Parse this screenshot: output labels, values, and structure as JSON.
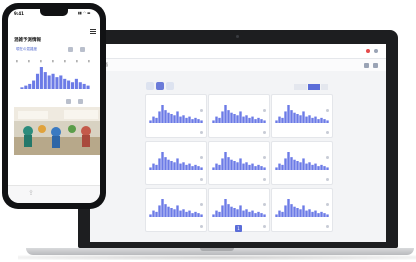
{
  "colors": {
    "accent": "#5b6dd8",
    "bar": "#6c7be6",
    "laptop": "#1d1e20",
    "phone": "#111214"
  },
  "laptop": {
    "chrome_title": "",
    "app_title": "日本語",
    "pager_current": "1",
    "cards": [
      {
        "title": "",
        "footer": ""
      },
      {
        "title": "",
        "footer": ""
      },
      {
        "title": "",
        "footer": ""
      },
      {
        "title": "",
        "footer": ""
      },
      {
        "title": "",
        "footer": ""
      },
      {
        "title": "",
        "footer": ""
      },
      {
        "title": "",
        "footer": ""
      },
      {
        "title": "",
        "footer": ""
      },
      {
        "title": "",
        "footer": ""
      }
    ],
    "toolbar_icons": [
      "chart-icon",
      "grid-icon",
      "line-icon"
    ],
    "segment_labels": [
      "",
      "",
      ""
    ],
    "chart_data": {
      "type": "bar",
      "values": [
        2,
        5,
        4,
        9,
        14,
        10,
        8,
        7,
        6,
        9,
        5,
        6,
        4,
        5,
        3,
        4,
        3,
        2
      ]
    }
  },
  "phone": {
    "status_time": "9:41",
    "status_icons": "▮▮ ◠ ▬",
    "title": "混雑予測情報",
    "subtitle": "現在の混雑度",
    "footer": "",
    "share_icon": "share-icon",
    "slide_label": "",
    "chart_data": {
      "type": "bar",
      "values": [
        1,
        2,
        3,
        5,
        9,
        13,
        10,
        8,
        9,
        7,
        8,
        6,
        5,
        4,
        6,
        4,
        3,
        2
      ]
    }
  }
}
